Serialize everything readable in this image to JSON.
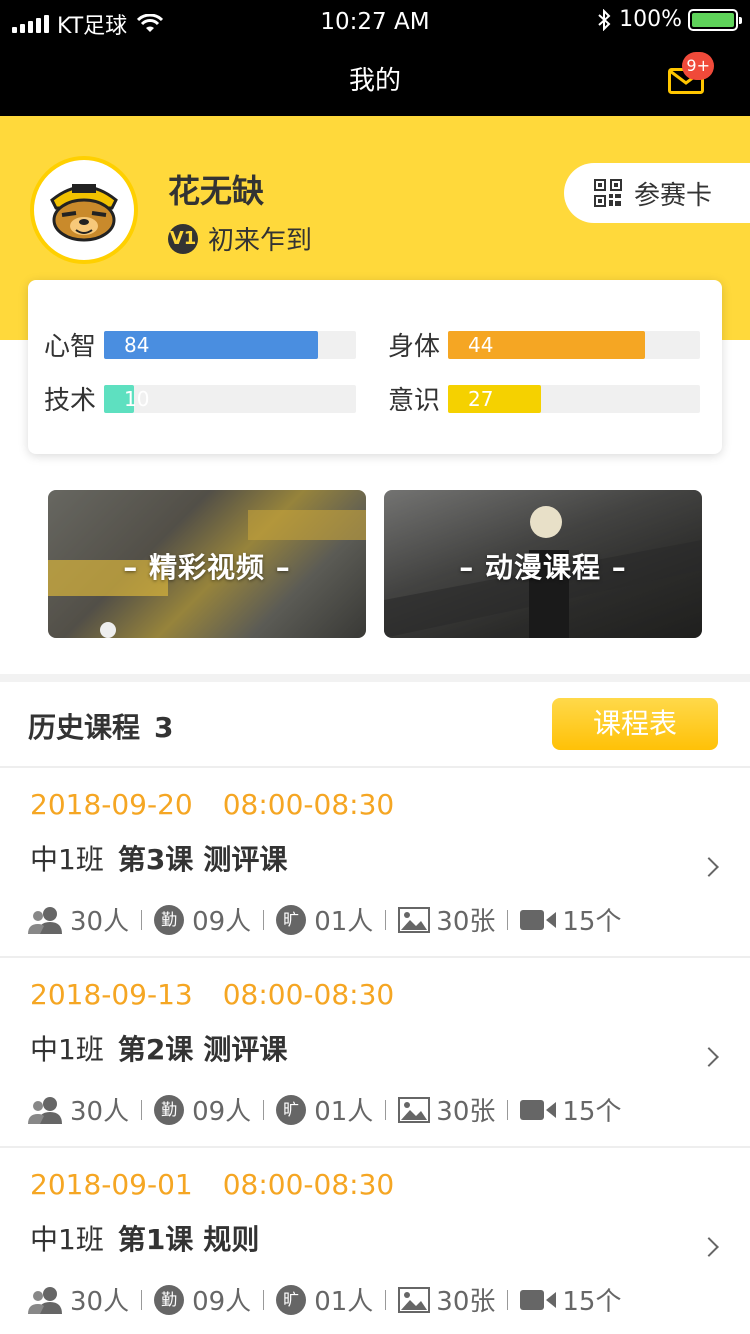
{
  "status_bar": {
    "carrier": "KT足球",
    "time": "10:27 AM",
    "battery": "100%",
    "battery_level": 1.0
  },
  "nav": {
    "title": "我的",
    "mail_badge": "9+"
  },
  "profile": {
    "name": "花无缺",
    "level_icon": "V1",
    "level": "初来乍到",
    "card_button": "参赛卡"
  },
  "stats": [
    {
      "label": "心智",
      "value": "84",
      "level": 0.85,
      "color": "#4a8ee0"
    },
    {
      "label": "身体",
      "value": "44",
      "level": 0.78,
      "color": "#f5a623"
    },
    {
      "label": "技术",
      "value": "10",
      "level": 0.12,
      "color": "#5ee0c0"
    },
    {
      "label": "意识",
      "value": "27",
      "level": 0.37,
      "color": "#f5d100"
    }
  ],
  "banners": [
    {
      "label": "– 精彩视频 –"
    },
    {
      "label": "– 动漫课程 –"
    }
  ],
  "history": {
    "title": "历史课程",
    "count": "3",
    "schedule_button": "课程表",
    "courses": [
      {
        "date": "2018-09-20",
        "time": "08:00-08:30",
        "class": "中1班",
        "lesson": "第3课",
        "type": "测评课",
        "people": "30人",
        "present_icon": "勤",
        "present": "09人",
        "absent_icon": "旷",
        "absent": "01人",
        "photos": "30张",
        "videos": "15个"
      },
      {
        "date": "2018-09-13",
        "time": "08:00-08:30",
        "class": "中1班",
        "lesson": "第2课",
        "type": "测评课",
        "people": "30人",
        "present_icon": "勤",
        "present": "09人",
        "absent_icon": "旷",
        "absent": "01人",
        "photos": "30张",
        "videos": "15个"
      },
      {
        "date": "2018-09-01",
        "time": "08:00-08:30",
        "class": "中1班",
        "lesson": "第1课",
        "type": "规则",
        "people": "30人",
        "present_icon": "勤",
        "present": "09人",
        "absent_icon": "旷",
        "absent": "01人",
        "photos": "30张",
        "videos": "15个"
      }
    ]
  },
  "colors": {
    "accent_yellow": "#ffd93b",
    "date_orange": "#f5a623",
    "badge_red": "#f04a3a"
  }
}
